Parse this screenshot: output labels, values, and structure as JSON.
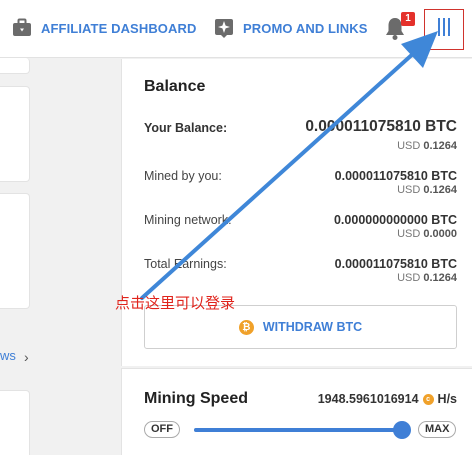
{
  "nav": {
    "affiliate_label": "AFFILIATE DASHBOARD",
    "promo_label": "PROMO AND LINKS",
    "notification_count": "1",
    "icons": {
      "affiliate": "briefcase-icon",
      "promo": "sparkle-icon",
      "notifications": "bell-icon",
      "menu": "hamburger-menu-icon"
    }
  },
  "left": {
    "view_more_text": "ws",
    "view_more_arrow": "›"
  },
  "balance": {
    "title": "Balance",
    "rows": [
      {
        "label": "Your Balance:",
        "btc": "0.000011075810 BTC",
        "usd_prefix": "USD ",
        "usd": "0.1264"
      },
      {
        "label": "Mined by you:",
        "btc": "0.000011075810 BTC",
        "usd_prefix": "USD ",
        "usd": "0.1264"
      },
      {
        "label": "Mining network:",
        "btc": "0.000000000000 BTC",
        "usd_prefix": "USD ",
        "usd": "0.0000"
      },
      {
        "label": "Total Earnings:",
        "btc": "0.000011075810 BTC",
        "usd_prefix": "USD ",
        "usd": "0.1264"
      }
    ],
    "withdraw_label": "WITHDRAW BTC",
    "coin_symbol": "₿"
  },
  "mining_speed": {
    "title": "Mining Speed",
    "value": "1948.5961016914",
    "unit": "H/s",
    "coin_symbol": "c",
    "off_label": "OFF",
    "max_label": "MAX",
    "slider_fraction": 1.0
  },
  "annotation": {
    "text": "点击这里可以登录",
    "color": "#e0241c",
    "arrow_color": "#3f87d8"
  },
  "colors": {
    "accent": "#3f7fd6",
    "badge": "#e4312b",
    "coin": "#f0a12a",
    "menu_border": "#d0332d"
  }
}
